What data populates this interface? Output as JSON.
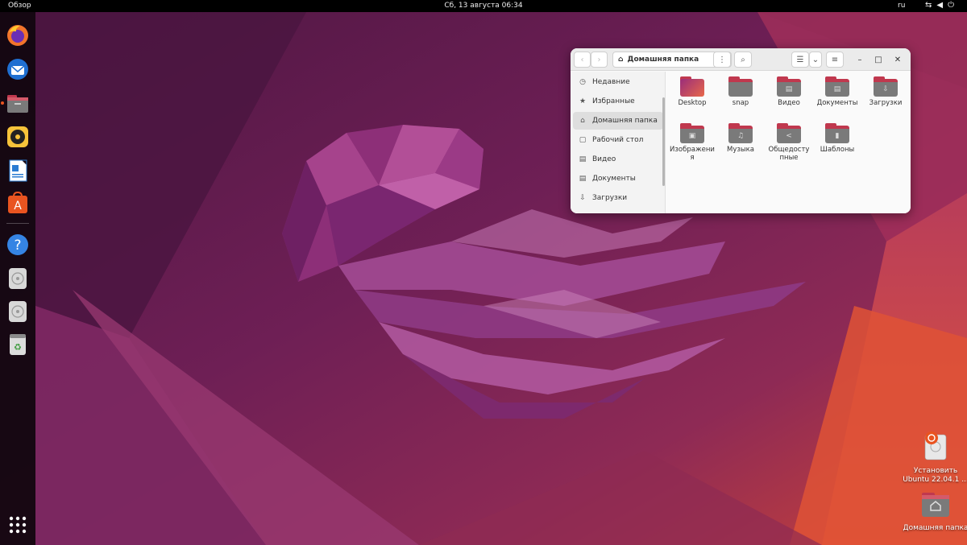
{
  "topbar": {
    "activities": "Обзор",
    "datetime": "Сб, 13 августа  06:34",
    "language": "ru",
    "tray_icons": [
      "network-icon",
      "volume-icon",
      "power-icon"
    ]
  },
  "dock": {
    "items": [
      {
        "name": "firefox",
        "icon": "firefox-icon",
        "running": false
      },
      {
        "name": "thunderbird",
        "icon": "thunderbird-icon",
        "running": false
      },
      {
        "name": "files",
        "icon": "files-icon",
        "running": true
      },
      {
        "name": "rhythmbox",
        "icon": "rhythmbox-icon",
        "running": false
      },
      {
        "name": "libreoffice-writer",
        "icon": "writer-icon",
        "running": false
      },
      {
        "name": "ubuntu-software",
        "icon": "software-icon",
        "running": false
      },
      {
        "name": "help",
        "icon": "help-icon",
        "running": false
      },
      {
        "name": "disc-1",
        "icon": "disc-icon",
        "running": false
      },
      {
        "name": "disc-2",
        "icon": "disc-icon",
        "running": false
      },
      {
        "name": "trash",
        "icon": "trash-icon",
        "running": false
      }
    ],
    "app_grid": "app-grid-icon"
  },
  "window": {
    "path_label": "Домашняя папка",
    "sidebar": [
      {
        "icon": "clock-icon",
        "glyph": "◷",
        "label": "Недавние"
      },
      {
        "icon": "star-icon",
        "glyph": "★",
        "label": "Избранные"
      },
      {
        "icon": "home-icon",
        "glyph": "⌂",
        "label": "Домашняя папка",
        "active": true
      },
      {
        "icon": "desktop-icon",
        "glyph": "▢",
        "label": "Рабочий стол"
      },
      {
        "icon": "video-icon",
        "glyph": "▤",
        "label": "Видео"
      },
      {
        "icon": "document-icon",
        "glyph": "▤",
        "label": "Документы"
      },
      {
        "icon": "download-icon",
        "glyph": "⇩",
        "label": "Загрузки"
      }
    ],
    "files": [
      {
        "label": "Desktop",
        "glyph": "",
        "kind": "desktop"
      },
      {
        "label": "snap",
        "glyph": "",
        "kind": "plain"
      },
      {
        "label": "Видео",
        "glyph": "▤",
        "kind": "plain"
      },
      {
        "label": "Документы",
        "glyph": "▤",
        "kind": "plain"
      },
      {
        "label": "Загрузки",
        "glyph": "⇩",
        "kind": "plain"
      },
      {
        "label": "Изображения",
        "glyph": "▣",
        "kind": "plain"
      },
      {
        "label": "Музыка",
        "glyph": "♫",
        "kind": "plain"
      },
      {
        "label": "Общедоступные",
        "glyph": "<",
        "kind": "plain"
      },
      {
        "label": "Шаблоны",
        "glyph": "▮",
        "kind": "plain"
      }
    ]
  },
  "desktop": {
    "icons": [
      {
        "label": "Установить Ubuntu 22.04.1 ...",
        "icon": "installer-icon"
      },
      {
        "label": "Домашняя папка",
        "icon": "home-folder-icon"
      }
    ]
  },
  "colors": {
    "accent": "#e95420",
    "folder_tab": "#c0384e",
    "folder_body": "#7a7a7a",
    "dock_bg": "#10060e",
    "wallpaper_dark": "#4a1340",
    "wallpaper_light": "#d3453a"
  }
}
